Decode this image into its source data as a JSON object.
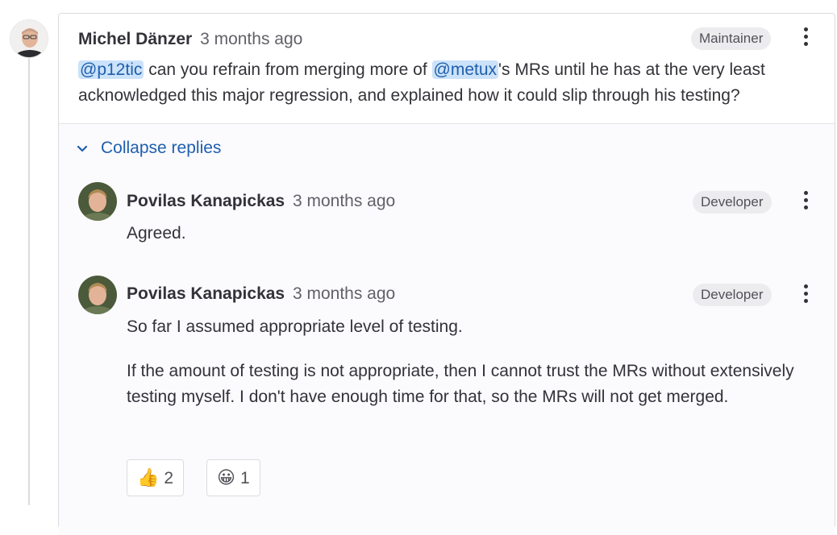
{
  "discussion": {
    "note": {
      "author": "Michel Dänzer",
      "time": "3 months ago",
      "role": "Maintainer",
      "mention1": "@p12tic",
      "text1": " can you refrain from merging more of ",
      "mention2": "@metux",
      "text2": "'s MRs until he has at the very least acknowledged this major regression, and explained how it could slip through his testing?"
    },
    "collapse_label": "Collapse replies",
    "replies": [
      {
        "author": "Povilas Kanapickas",
        "time": "3 months ago",
        "role": "Developer",
        "paragraphs": [
          "Agreed."
        ]
      },
      {
        "author": "Povilas Kanapickas",
        "time": "3 months ago",
        "role": "Developer",
        "paragraphs": [
          "So far I assumed appropriate level of testing.",
          "If the amount of testing is not appropriate, then I cannot trust the MRs without extensively testing myself. I don't have enough time for that, so the MRs will not get merged."
        ],
        "reactions": [
          {
            "emoji": "👍",
            "count": "2",
            "icon": "thumbsup-icon"
          },
          {
            "emoji": "😀",
            "count": "1",
            "icon": "grinning-face-icon"
          }
        ]
      }
    ]
  }
}
